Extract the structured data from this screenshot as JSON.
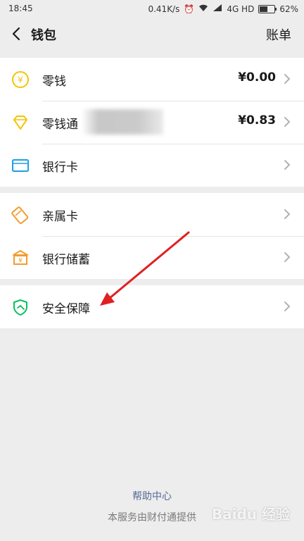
{
  "status_bar": {
    "time": "18:45",
    "speed": "0.41K/s",
    "network": "4G HD",
    "battery": "62%",
    "battery_level": 0.62
  },
  "header": {
    "title": "钱包",
    "right_action": "账单"
  },
  "groups": [
    {
      "items": [
        {
          "label": "零钱",
          "value": "¥0.00",
          "icon": "coin-icon"
        },
        {
          "label": "零钱通",
          "value": "¥0.83",
          "icon": "diamond-icon"
        },
        {
          "label": "银行卡",
          "value": "",
          "icon": "card-icon"
        }
      ]
    },
    {
      "items": [
        {
          "label": "亲属卡",
          "value": "",
          "icon": "family-card-icon"
        },
        {
          "label": "银行储蓄",
          "value": "",
          "icon": "bank-icon"
        }
      ]
    },
    {
      "items": [
        {
          "label": "安全保障",
          "value": "",
          "icon": "shield-icon"
        }
      ]
    }
  ],
  "footer": {
    "help_link": "帮助中心",
    "provider_note": "本服务由财付通提供"
  },
  "watermark": "Baidu 经验",
  "colors": {
    "accent_yellow": "#f5c400",
    "icon_blue": "#1aa1e6",
    "icon_orange": "#f39c2d",
    "icon_green": "#07c160",
    "link_blue": "#576b95",
    "annotation_red": "#e02020"
  }
}
